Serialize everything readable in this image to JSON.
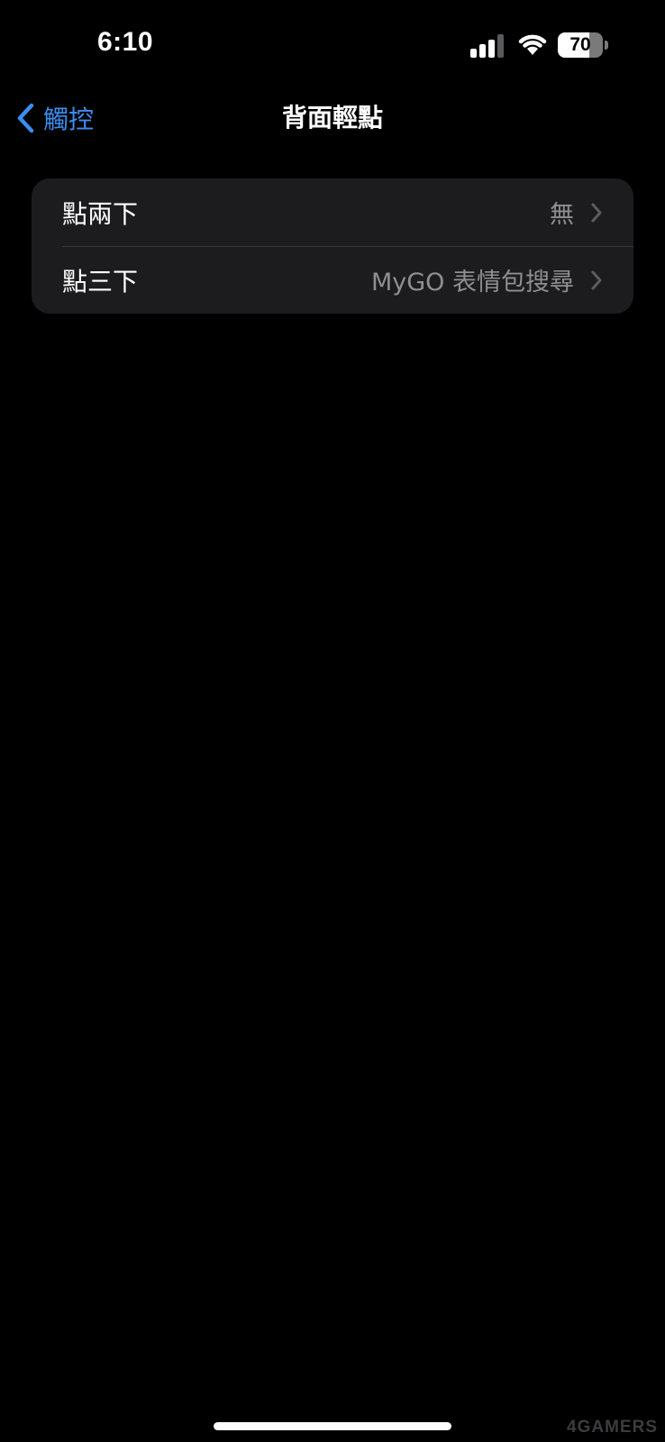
{
  "status_bar": {
    "time": "6:10",
    "battery_percent": "70",
    "battery_level": 0.7,
    "signal_icon": "cellular-signal-icon",
    "wifi_icon": "wifi-icon"
  },
  "nav": {
    "back_label": "觸控",
    "back_icon": "chevron-left-icon",
    "title": "背面輕點"
  },
  "rows": [
    {
      "label": "點兩下",
      "value": "無"
    },
    {
      "label": "點三下",
      "value": "MyGO 表情包搜尋"
    }
  ],
  "watermark": "4GAMERS",
  "colors": {
    "accent": "#3b8ef0",
    "background": "#000000",
    "group_background": "#1c1c1e",
    "secondary_text": "#8e8e93",
    "separator": "#38383a"
  }
}
